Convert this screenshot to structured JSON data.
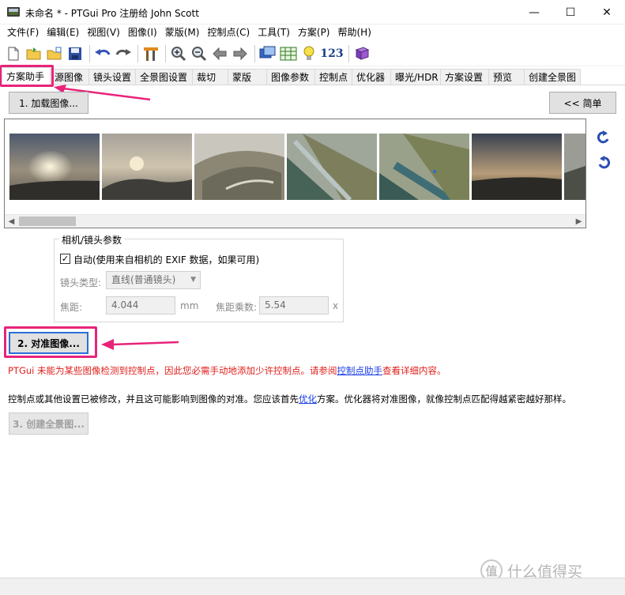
{
  "window": {
    "title": "未命名 * - PTGui Pro 注册给 John Scott",
    "minimize": "—",
    "maximize": "☐",
    "close": "✕"
  },
  "menu": [
    "文件(F)",
    "编辑(E)",
    "视图(V)",
    "图像(I)",
    "蒙版(M)",
    "控制点(C)",
    "工具(T)",
    "方案(P)",
    "帮助(H)"
  ],
  "toolbar": {
    "icons": [
      "new-file-icon",
      "open-folder-icon",
      "open-recent-icon",
      "save-icon",
      "undo-icon",
      "redo-icon",
      "tools-icon",
      "zoom-in-icon",
      "zoom-out-icon",
      "arrow-left-icon",
      "arrow-right-icon",
      "panorama-editor-icon",
      "table-icon",
      "lightbulb-icon",
      "numbers-icon",
      "book-icon"
    ],
    "numbers_label": "123"
  },
  "tabs": [
    "方案助手",
    "源图像",
    "镜头设置",
    "全景图设置",
    "裁切",
    "蒙版",
    "图像参数",
    "控制点",
    "优化器",
    "曝光/HDR",
    "方案设置",
    "预览",
    "创建全景图"
  ],
  "active_tab": 0,
  "buttons": {
    "load_images": "1. 加载图像...",
    "simple": "<< 简单",
    "align_images": "2. 对准图像...",
    "create_panorama": "3. 创建全景图..."
  },
  "camera_group": {
    "legend": "相机/镜头参数",
    "auto_checked": true,
    "auto_label": "自动(使用来自相机的 EXIF 数据，如果可用)",
    "lens_type_label": "镜头类型:",
    "lens_type_value": "直线(普通镜头)",
    "focal_label": "焦距:",
    "focal_value": "4.044",
    "focal_unit": "mm",
    "crop_label": "焦距乘数:",
    "crop_value": "5.54",
    "crop_unit": "x"
  },
  "warning": {
    "before": "PTGui 未能为某些图像检测到控制点，因此您必需手动地添加少许控制点。请参阅",
    "link": "控制点助手",
    "after": "查看详细内容。"
  },
  "note": {
    "before": "控制点或其他设置已被修改，并且这可能影响到图像的对准。您应该首先",
    "link": "优化",
    "after": "方案。优化器将对准图像，就像控制点匹配得越紧密越好那样。"
  },
  "watermark": {
    "badge": "值",
    "text": "什么值得买"
  },
  "colors": {
    "highlight": "#e8247a",
    "warning": "#e0201c",
    "link": "#1a3ee8"
  }
}
